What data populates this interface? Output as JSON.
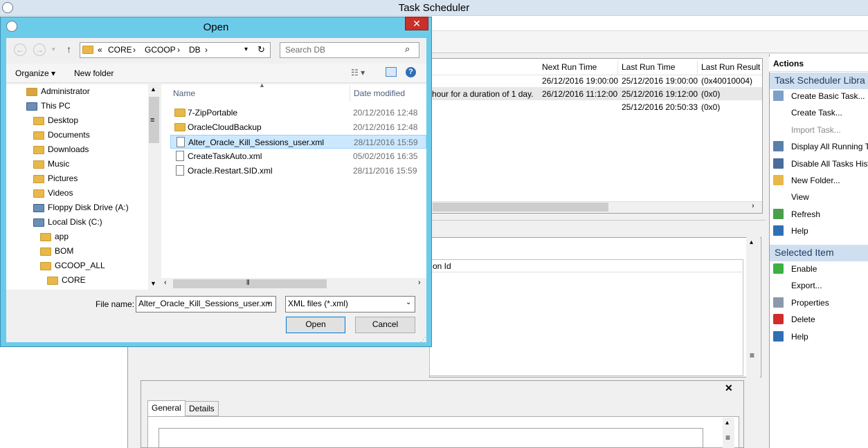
{
  "scheduler": {
    "title": "Task Scheduler",
    "columns": [
      "Next Run Time",
      "Last Run Time",
      "Last Run Result"
    ],
    "rows": [
      {
        "partial": "",
        "next": "26/12/2016 19:00:00",
        "last": "25/12/2016 19:00:00",
        "result": "(0x40010004)"
      },
      {
        "partial": "hour for a duration of 1 day.",
        "next": "26/12/2016 11:12:00",
        "last": "25/12/2016 19:12:00",
        "result": "(0x0)"
      },
      {
        "partial": "",
        "next": "",
        "last": "25/12/2016 20:50:33",
        "result": "(0x0)"
      }
    ],
    "trigger_col": "on Id",
    "close_glyph": "✕",
    "tabs": [
      "General",
      "Details"
    ]
  },
  "actions": {
    "title": "Actions",
    "library_header": "Task Scheduler Libra",
    "library_items": [
      {
        "label": "Create Basic Task...",
        "icon": "wizard-icon",
        "disabled": false
      },
      {
        "label": "Create Task...",
        "icon": "",
        "disabled": false
      },
      {
        "label": "Import Task...",
        "icon": "",
        "disabled": true
      },
      {
        "label": "Display All Running T",
        "icon": "list-icon",
        "disabled": false
      },
      {
        "label": "Disable All Tasks Hist",
        "icon": "history-icon",
        "disabled": false
      },
      {
        "label": "New Folder...",
        "icon": "folder-icon",
        "disabled": false
      },
      {
        "label": "View",
        "icon": "",
        "disabled": false
      },
      {
        "label": "Refresh",
        "icon": "refresh-icon",
        "disabled": false
      },
      {
        "label": "Help",
        "icon": "help-icon",
        "disabled": false
      }
    ],
    "selected_header": "Selected Item",
    "selected_items": [
      {
        "label": "Enable",
        "icon": "enable-arrow-icon",
        "disabled": false
      },
      {
        "label": "Export...",
        "icon": "",
        "disabled": false
      },
      {
        "label": "Properties",
        "icon": "properties-icon",
        "disabled": false
      },
      {
        "label": "Delete",
        "icon": "delete-icon",
        "disabled": false
      },
      {
        "label": "Help",
        "icon": "help-icon",
        "disabled": false
      }
    ]
  },
  "dialog": {
    "title": "Open",
    "close_glyph": "✕",
    "breadcrumb": [
      "«",
      "CORE",
      "›",
      "GCOOP",
      "›",
      "DB",
      "›"
    ],
    "search_placeholder": "Search DB",
    "organize": "Organize ▾",
    "new_folder": "New folder",
    "tree": [
      {
        "label": "Administrator",
        "indent": 0,
        "icon": "user-folder-icon"
      },
      {
        "label": "This PC",
        "indent": 0,
        "icon": "pc-icon"
      },
      {
        "label": "Desktop",
        "indent": 1,
        "icon": "folder-icon"
      },
      {
        "label": "Documents",
        "indent": 1,
        "icon": "folder-icon"
      },
      {
        "label": "Downloads",
        "indent": 1,
        "icon": "folder-icon"
      },
      {
        "label": "Music",
        "indent": 1,
        "icon": "folder-icon"
      },
      {
        "label": "Pictures",
        "indent": 1,
        "icon": "folder-icon"
      },
      {
        "label": "Videos",
        "indent": 1,
        "icon": "folder-icon"
      },
      {
        "label": "Floppy Disk Drive (A:)",
        "indent": 1,
        "icon": "floppy-icon"
      },
      {
        "label": "Local Disk (C:)",
        "indent": 1,
        "icon": "disk-icon"
      },
      {
        "label": "app",
        "indent": 2,
        "icon": "folder-icon"
      },
      {
        "label": "BOM",
        "indent": 2,
        "icon": "folder-icon"
      },
      {
        "label": "GCOOP_ALL",
        "indent": 2,
        "icon": "folder-icon"
      },
      {
        "label": "CORE",
        "indent": 3,
        "icon": "folder-icon"
      }
    ],
    "columns": {
      "name": "Name",
      "date": "Date modified"
    },
    "files": [
      {
        "name": "7-ZipPortable",
        "date": "20/12/2016 12:48",
        "type": "folder",
        "selected": false
      },
      {
        "name": "OracleCloudBackup",
        "date": "20/12/2016 12:48",
        "type": "folder",
        "selected": false
      },
      {
        "name": "Alter_Oracle_Kill_Sessions_user.xml",
        "date": "28/11/2016 15:59",
        "type": "file",
        "selected": true
      },
      {
        "name": "CreateTaskAuto.xml",
        "date": "05/02/2016 16:35",
        "type": "file",
        "selected": false
      },
      {
        "name": "Oracle.Restart.SID.xml",
        "date": "28/11/2016 15:59",
        "type": "file",
        "selected": false
      }
    ],
    "file_name_label": "File name:",
    "file_name_value": "Alter_Oracle_Kill_Sessions_user.xm",
    "file_type": "XML files (*.xml)",
    "open_button": "Open",
    "cancel_button": "Cancel"
  }
}
